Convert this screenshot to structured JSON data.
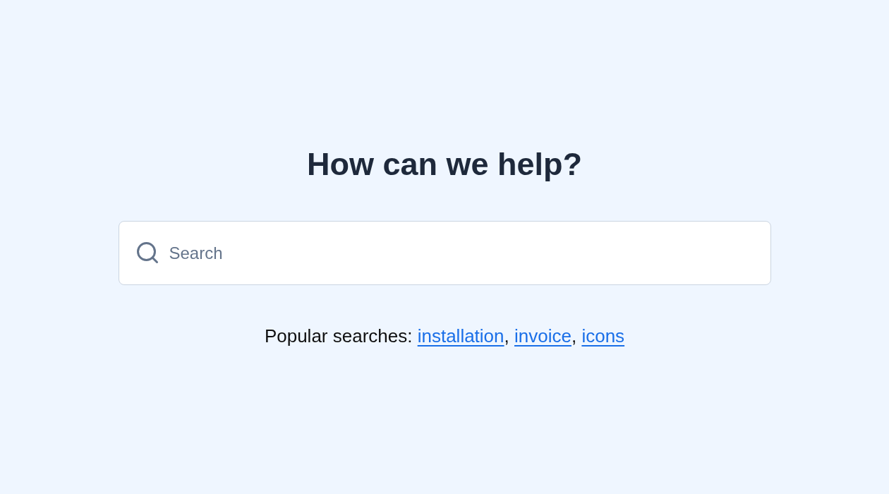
{
  "heading": "How can we help?",
  "search": {
    "placeholder": "Search"
  },
  "popular_searches": {
    "label": "Popular searches:",
    "separator": ",",
    "links": [
      {
        "label": "installation"
      },
      {
        "label": "invoice"
      },
      {
        "label": "icons"
      }
    ]
  }
}
